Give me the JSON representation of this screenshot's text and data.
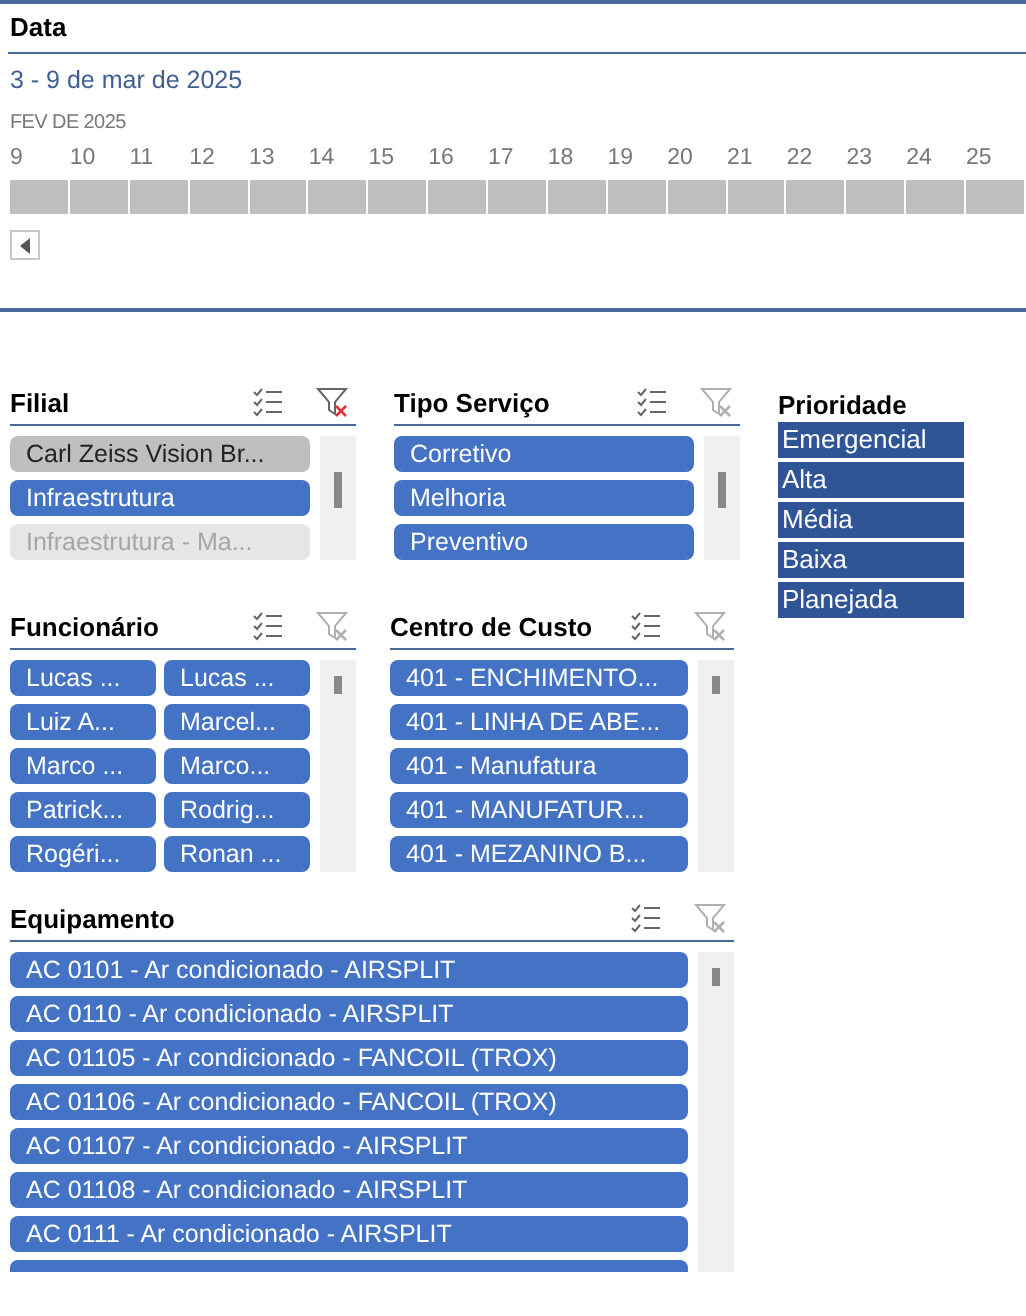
{
  "timeline": {
    "title": "Data",
    "range": "3 - 9 de mar de 2025",
    "month": "FEV DE 2025",
    "days": [
      "9",
      "10",
      "11",
      "12",
      "13",
      "14",
      "15",
      "16",
      "17",
      "18",
      "19",
      "20",
      "21",
      "22",
      "23",
      "24",
      "25"
    ]
  },
  "slicers": [
    {
      "title": "Filial",
      "filtered": true,
      "items": [
        {
          "label": "Carl Zeiss Vision Br...",
          "selected": false,
          "has_data": true
        },
        {
          "label": "Infraestrutura",
          "selected": true,
          "has_data": true
        },
        {
          "label": "Infraestrutura - Ma...",
          "selected": false,
          "has_data": false
        }
      ]
    },
    {
      "title": "Tipo Serviço",
      "filtered": false,
      "items": [
        {
          "label": "Corretivo",
          "selected": true,
          "has_data": true
        },
        {
          "label": "Melhoria",
          "selected": true,
          "has_data": true
        },
        {
          "label": "Preventivo",
          "selected": true,
          "has_data": true
        }
      ]
    },
    {
      "title": "Funcionário",
      "filtered": false,
      "items": [
        {
          "label": "Lucas ...",
          "selected": true,
          "has_data": true
        },
        {
          "label": "Lucas ...",
          "selected": true,
          "has_data": true
        },
        {
          "label": "Luiz A...",
          "selected": true,
          "has_data": true
        },
        {
          "label": "Marcel...",
          "selected": true,
          "has_data": true
        },
        {
          "label": "Marco ...",
          "selected": true,
          "has_data": true
        },
        {
          "label": "Marco...",
          "selected": true,
          "has_data": true
        },
        {
          "label": "Patrick...",
          "selected": true,
          "has_data": true
        },
        {
          "label": "Rodrig...",
          "selected": true,
          "has_data": true
        },
        {
          "label": "Rogéri...",
          "selected": true,
          "has_data": true
        },
        {
          "label": "Ronan ...",
          "selected": true,
          "has_data": true
        }
      ]
    },
    {
      "title": "Centro de Custo",
      "filtered": false,
      "items": [
        {
          "label": "401 - ENCHIMENTO...",
          "selected": true,
          "has_data": true
        },
        {
          "label": "401 - LINHA DE ABE...",
          "selected": true,
          "has_data": true
        },
        {
          "label": "401 - Manufatura",
          "selected": true,
          "has_data": true
        },
        {
          "label": "401 - MANUFATUR...",
          "selected": true,
          "has_data": true
        },
        {
          "label": "401 - MEZANINO B...",
          "selected": true,
          "has_data": true
        }
      ]
    },
    {
      "title": "Equipamento",
      "filtered": false,
      "items": [
        {
          "label": "AC 0101 - Ar condicionado - AIRSPLIT",
          "selected": true,
          "has_data": true
        },
        {
          "label": "AC 0110 - Ar condicionado - AIRSPLIT",
          "selected": true,
          "has_data": true
        },
        {
          "label": "AC 01105 - Ar condicionado - FANCOIL (TROX)",
          "selected": true,
          "has_data": true
        },
        {
          "label": "AC 01106 - Ar condicionado - FANCOIL (TROX)",
          "selected": true,
          "has_data": true
        },
        {
          "label": "AC 01107 - Ar condicionado - AIRSPLIT",
          "selected": true,
          "has_data": true
        },
        {
          "label": "AC 01108 - Ar condicionado - AIRSPLIT",
          "selected": true,
          "has_data": true
        },
        {
          "label": "AC 0111 - Ar condicionado - AIRSPLIT",
          "selected": true,
          "has_data": true
        }
      ]
    }
  ],
  "priority": {
    "title": "Prioridade",
    "items": [
      "Emergencial",
      "Alta",
      "Média",
      "Baixa",
      "Planejada"
    ]
  }
}
